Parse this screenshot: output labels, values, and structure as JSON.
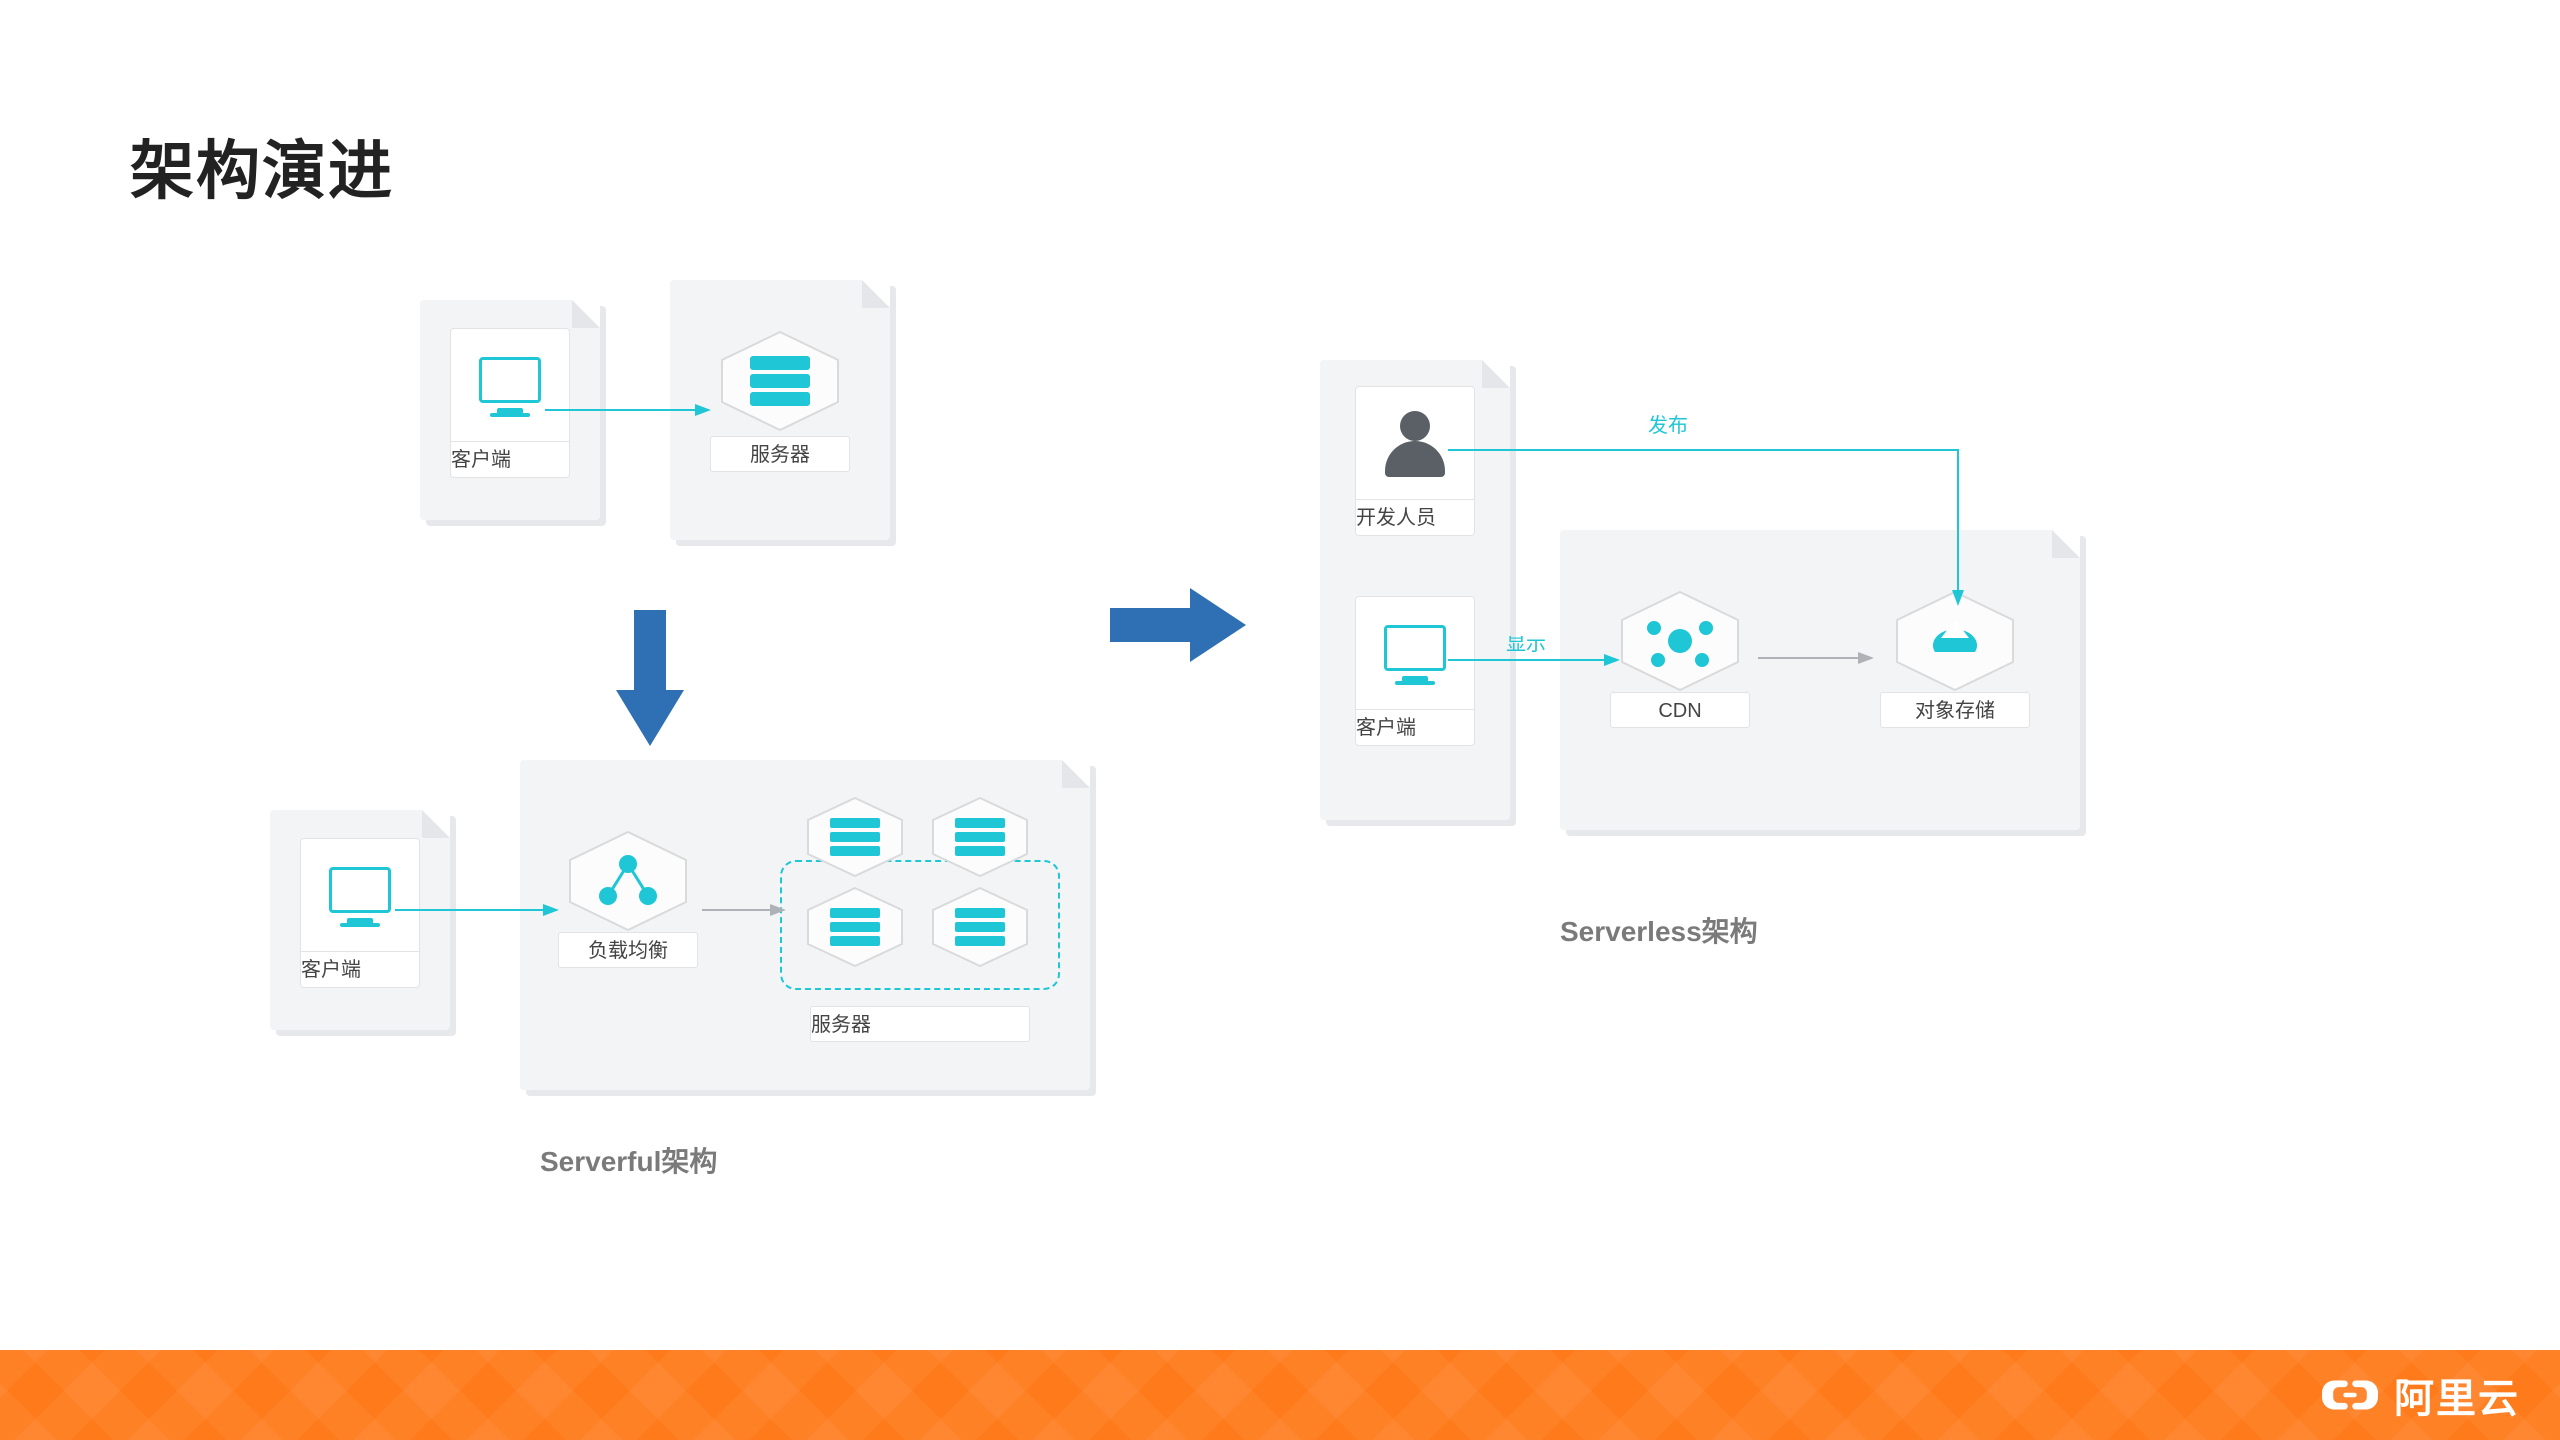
{
  "title": "架构演进",
  "left_section_label": "Serverful架构",
  "right_section_label": "Serverless架构",
  "nodes": {
    "client": "客户端",
    "server": "服务器",
    "lb": "负载均衡",
    "server_group": "服务器",
    "dev": "开发人员",
    "cdn": "CDN",
    "oss": "对象存储"
  },
  "edges": {
    "publish": "发布",
    "display": "显示"
  },
  "brand": "阿里云"
}
